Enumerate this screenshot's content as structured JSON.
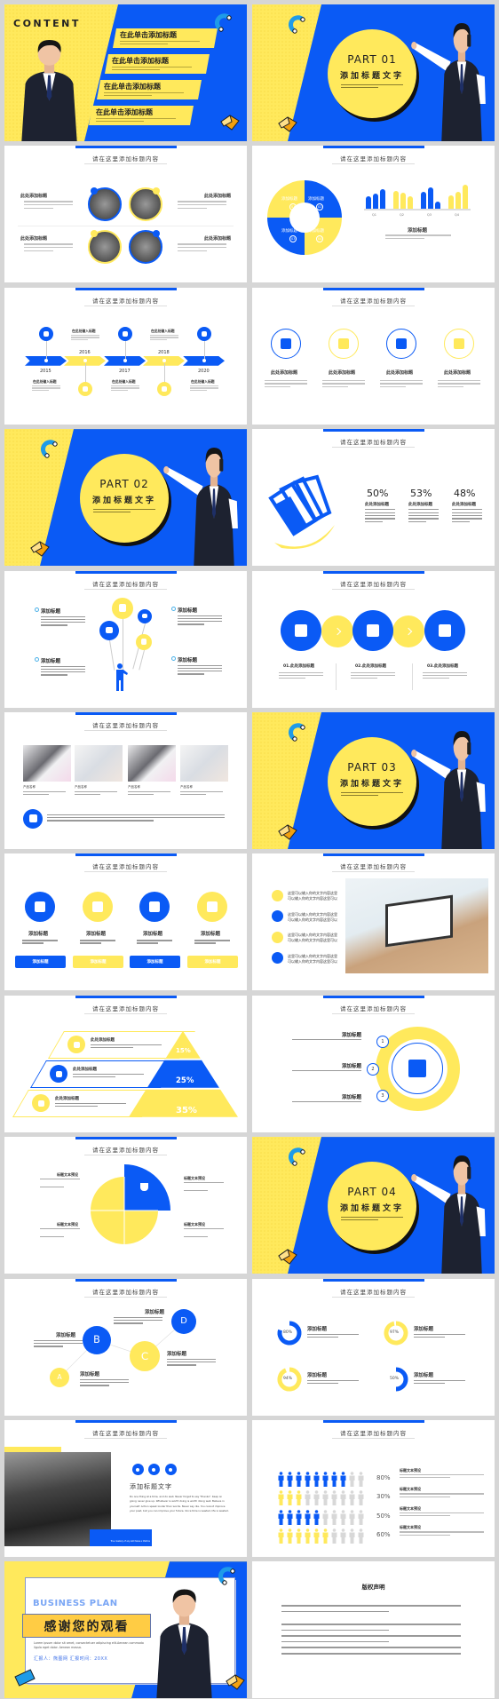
{
  "colors": {
    "blue": "#0a5af5",
    "yellow": "#ffe95c",
    "dark": "#222222"
  },
  "slides": [
    {
      "type": "contents",
      "heading": "CONTENT",
      "items": [
        "在此单击添加标题",
        "在此单击添加标题",
        "在此单击添加标题",
        "在此单击添加标题"
      ]
    },
    {
      "type": "part",
      "part": "PART 01",
      "title": "添加标题文字"
    },
    {
      "type": "photo-circles",
      "title": "请在这里添加标题内容",
      "items": [
        "此处添加标题",
        "此处添加标题",
        "此处添加标题",
        "此处添加标题"
      ]
    },
    {
      "type": "cycle-bars",
      "title": "请在这里添加标题内容",
      "cycle": [
        "添加标题",
        "添加标题",
        "添加标题",
        "添加标题"
      ],
      "cycle_numbers": [
        "01",
        "02",
        "03",
        "04"
      ],
      "bars": {
        "categories": [
          "Q1",
          "Q2",
          "Q3",
          "Q4"
        ],
        "values": [
          [
            40,
            50,
            65
          ],
          [
            58,
            52,
            40
          ],
          [
            55,
            70,
            25
          ],
          [
            45,
            55,
            78
          ]
        ]
      },
      "caption": "添加标题"
    },
    {
      "type": "timeline",
      "title": "请在这里添加标题内容",
      "years": [
        "2015",
        "2016",
        "2017",
        "2018",
        "2020"
      ],
      "labels": [
        "在此处输入标题",
        "在此处输入标题",
        "在此处输入标题",
        "在此处输入标题",
        "在此处输入标题"
      ],
      "icons": [
        "home",
        "search",
        "chart",
        "gear",
        "trophy"
      ]
    },
    {
      "type": "icon-row",
      "title": "请在这里添加标题内容",
      "items": [
        "此处添加标题",
        "此处添加标题",
        "此处添加标题",
        "此处添加标题"
      ],
      "icons": [
        "user-money",
        "money-bag",
        "clock-24h",
        "coin-hand"
      ]
    },
    {
      "type": "part",
      "part": "PART 02",
      "title": "添加标题文字"
    },
    {
      "type": "percent-money",
      "title": "请在这里添加标题内容",
      "items": [
        {
          "value": "50%",
          "label": "此处添加标题"
        },
        {
          "value": "53%",
          "label": "此处添加标题"
        },
        {
          "value": "48%",
          "label": "此处添加标题"
        }
      ]
    },
    {
      "type": "balloons",
      "title": "请在这里添加标题内容",
      "items": [
        "添加标题",
        "添加标题",
        "添加标题",
        "添加标题"
      ]
    },
    {
      "type": "process",
      "title": "请在这里添加标题内容",
      "items": [
        "01.此处添加标题",
        "02.此处添加标题",
        "03.此处添加标题"
      ],
      "icons": [
        "cash-register",
        "atm",
        "coins"
      ]
    },
    {
      "type": "products",
      "title": "请在这里添加标题内容",
      "items": [
        "产品名称",
        "产品名称",
        "产品名称",
        "产品名称"
      ]
    },
    {
      "type": "part",
      "part": "PART 03",
      "title": "添加标题文字"
    },
    {
      "type": "buttons",
      "title": "请在这里添加标题内容",
      "items": [
        "添加标题",
        "添加标题",
        "添加标题",
        "添加标题"
      ],
      "buttons": [
        "添加标题",
        "添加标题",
        "添加标题",
        "添加标题"
      ],
      "icons": [
        "doctor",
        "hospital",
        "microscope",
        "heartbeat"
      ]
    },
    {
      "type": "checklist",
      "title": "请在这里添加标题内容",
      "items": [
        {
          "l1": "这里可以输入你的文字内容这里",
          "l2": "可以输入你的文字内容这里可以",
          "state": "check"
        },
        {
          "l1": "这里可以输入你的文字内容这里",
          "l2": "可以输入你的文字内容这里可以",
          "state": "check"
        },
        {
          "l1": "这里可以输入你的文字内容这里",
          "l2": "可以输入你的文字内容这里可以",
          "state": "check"
        },
        {
          "l1": "这里可以输入你的文字内容这里",
          "l2": "可以输入你的文字内容这里可以",
          "state": "cross"
        }
      ]
    },
    {
      "type": "pyramid",
      "title": "请在这里添加标题内容",
      "items": [
        {
          "label": "此处添加标题",
          "value": "15%"
        },
        {
          "label": "此处添加标题",
          "value": "25%"
        },
        {
          "label": "此处添加标题",
          "value": "35%"
        }
      ]
    },
    {
      "type": "steps",
      "title": "请在这里添加标题内容",
      "items": [
        {
          "num": "1",
          "label": "添加标题"
        },
        {
          "num": "2",
          "label": "添加标题"
        },
        {
          "num": "3",
          "label": "添加标题"
        }
      ]
    },
    {
      "type": "pie",
      "title": "请在这里添加标题内容",
      "items": [
        "标题文本预设",
        "标题文本预设",
        "标题文本预设",
        "标题文本预设"
      ]
    },
    {
      "type": "part",
      "part": "PART 04",
      "title": "添加标题文字"
    },
    {
      "type": "abcd",
      "title": "请在这里添加标题内容",
      "nodes": [
        "A",
        "B",
        "C",
        "D"
      ],
      "items": [
        "添加标题",
        "添加标题",
        "添加标题",
        "添加标题"
      ]
    },
    {
      "type": "donuts",
      "title": "请在这里添加标题内容",
      "items": [
        {
          "value": "80%",
          "pct": 80,
          "label": "添加标题",
          "color": "blue"
        },
        {
          "value": "97%",
          "pct": 97,
          "label": "添加标题",
          "color": "yellow"
        },
        {
          "value": "94%",
          "pct": 94,
          "label": "添加标题",
          "color": "yellow"
        },
        {
          "value": "50%",
          "pct": 50,
          "label": "添加标题",
          "color": "blue"
        }
      ]
    },
    {
      "type": "photo-text",
      "title": "请在这里添加标题内容",
      "heading": "添加标题文字",
      "body": "Do one thing at a time, and do well. Never forget to say \"thanks\". Keep on going never give up. Whatever is worth doing is worth doing well. Believe in yourself. Action speak louder than words. Never say die. You cannot improve your past, but you can improve your future. Once time is wasted, life is wasted.",
      "caption": "True mastery of any skill takes a lifetime"
    },
    {
      "type": "people",
      "title": "请在这里添加标题内容",
      "rows": [
        {
          "value": "80%",
          "filled": 8,
          "color": "blue",
          "label": "标题文本预设"
        },
        {
          "value": "30%",
          "filled": 3,
          "color": "yellow",
          "label": "标题文本预设"
        },
        {
          "value": "50%",
          "filled": 5,
          "color": "blue",
          "label": "标题文本预设"
        },
        {
          "value": "60%",
          "filled": 6,
          "color": "yellow",
          "label": "标题文本预设"
        }
      ]
    },
    {
      "type": "end",
      "eyebrow": "BUSINESS PLAN",
      "title": "感谢您的观看",
      "body": "Lorem ipsum dolor sit amet, consectetuer adipiscing elit.Aenean commodo ligula eget dolor. Aenean massa.",
      "reporter": "汇报人：熊图网 汇报时间：20XX"
    },
    {
      "type": "copyright",
      "title": "版权声明"
    }
  ]
}
